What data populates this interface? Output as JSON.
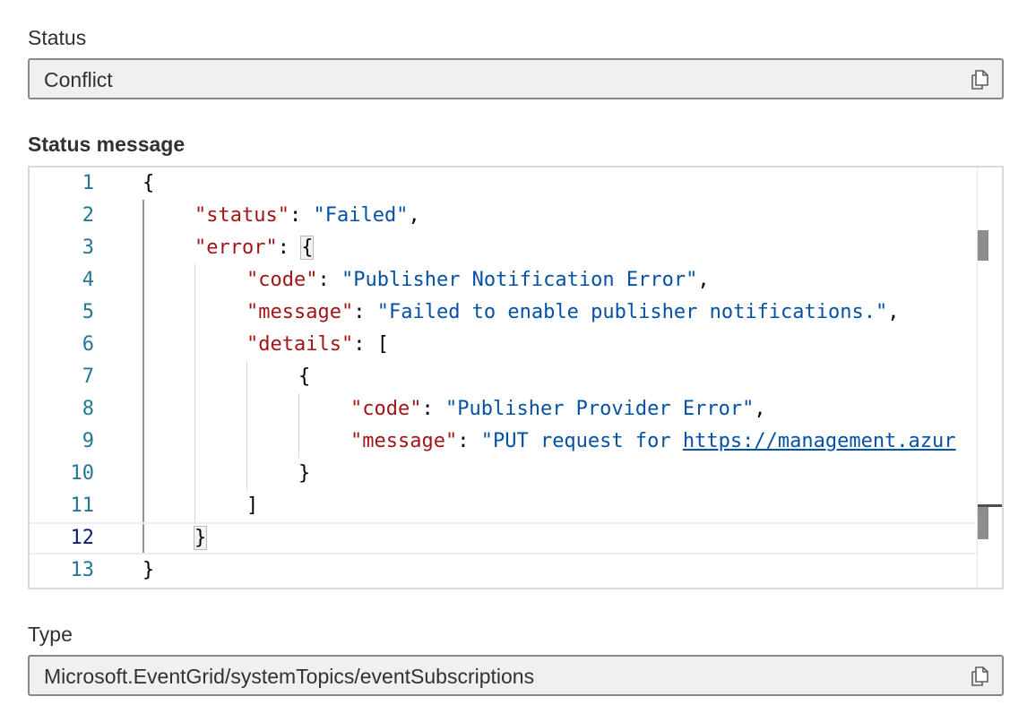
{
  "status": {
    "label": "Status",
    "value": "Conflict",
    "copy_icon": "copy-icon"
  },
  "status_message": {
    "label": "Status message",
    "lines": [
      {
        "n": "1",
        "parts": [
          [
            "p",
            "{"
          ]
        ]
      },
      {
        "n": "2",
        "parts": [
          [
            "k",
            "\"status\""
          ],
          [
            "p",
            ": "
          ],
          [
            "s",
            "\"Failed\""
          ],
          [
            "p",
            ","
          ]
        ]
      },
      {
        "n": "3",
        "parts": [
          [
            "k",
            "\"error\""
          ],
          [
            "p",
            ": "
          ],
          [
            "bh",
            "{"
          ]
        ]
      },
      {
        "n": "4",
        "parts": [
          [
            "k",
            "\"code\""
          ],
          [
            "p",
            ": "
          ],
          [
            "s",
            "\"Publisher Notification Error\""
          ],
          [
            "p",
            ","
          ]
        ]
      },
      {
        "n": "5",
        "parts": [
          [
            "k",
            "\"message\""
          ],
          [
            "p",
            ": "
          ],
          [
            "s",
            "\"Failed to enable publisher notifications.\""
          ],
          [
            "p",
            ","
          ]
        ]
      },
      {
        "n": "6",
        "parts": [
          [
            "k",
            "\"details\""
          ],
          [
            "p",
            ": ["
          ]
        ]
      },
      {
        "n": "7",
        "parts": [
          [
            "p",
            "{"
          ]
        ]
      },
      {
        "n": "8",
        "parts": [
          [
            "k",
            "\"code\""
          ],
          [
            "p",
            ": "
          ],
          [
            "s",
            "\"Publisher Provider Error\""
          ],
          [
            "p",
            ","
          ]
        ]
      },
      {
        "n": "9",
        "parts": [
          [
            "k",
            "\"message\""
          ],
          [
            "p",
            ": "
          ],
          [
            "s",
            "\"PUT request for "
          ],
          [
            "l",
            "https://management.azur"
          ]
        ]
      },
      {
        "n": "10",
        "parts": [
          [
            "p",
            "}"
          ]
        ]
      },
      {
        "n": "11",
        "parts": [
          [
            "p",
            "]"
          ]
        ]
      },
      {
        "n": "12",
        "parts": [
          [
            "bh",
            "}"
          ]
        ]
      },
      {
        "n": "13",
        "parts": [
          [
            "p",
            "}"
          ]
        ]
      }
    ],
    "current_line": "12"
  },
  "type": {
    "label": "Type",
    "value": "Microsoft.EventGrid/systemTopics/eventSubscriptions",
    "copy_icon": "copy-icon"
  },
  "colors": {
    "key": "#a31515",
    "string": "#0451a5",
    "line_number": "#237893",
    "field_background": "#f0f0f0"
  }
}
